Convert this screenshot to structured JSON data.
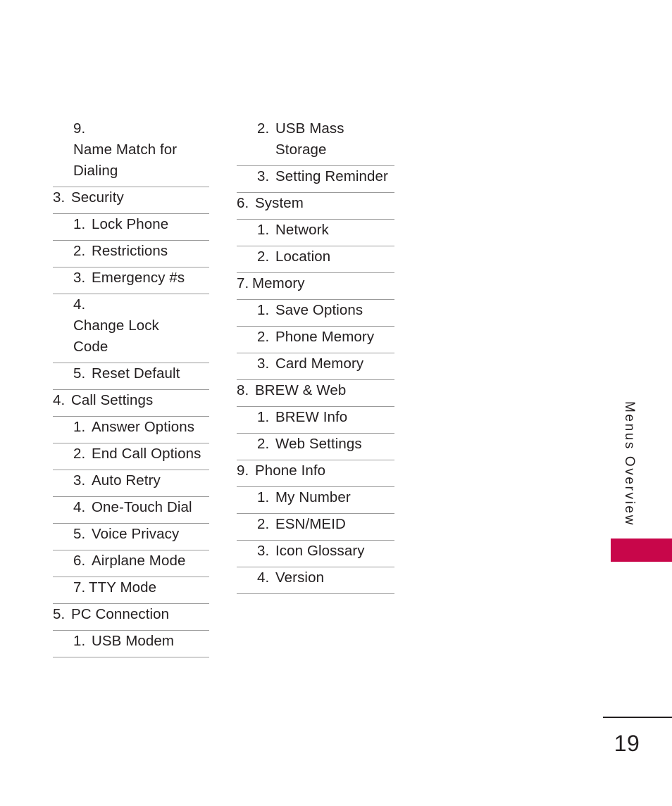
{
  "page": {
    "section_tab": "Menus Overview",
    "folio": "19",
    "accent_color": "#c8064a",
    "text_color": "#231f20",
    "rule_color": "#9b9b9b",
    "background": "#ffffff"
  },
  "columns": {
    "left": [
      {
        "num": "9.",
        "text": "Name Match for Dialing",
        "level": 2
      },
      {
        "num": "3.",
        "text": "Security",
        "level": 1
      },
      {
        "num": "1.",
        "text": "Lock Phone",
        "level": 2
      },
      {
        "num": "2.",
        "text": "Restrictions",
        "level": 2
      },
      {
        "num": "3.",
        "text": "Emergency #s",
        "level": 2
      },
      {
        "num": "4.",
        "text": "Change Lock Code",
        "level": 2
      },
      {
        "num": "5.",
        "text": "Reset Default",
        "level": 2
      },
      {
        "num": "4.",
        "text": "Call Settings",
        "level": 1
      },
      {
        "num": "1.",
        "text": "Answer Options",
        "level": 2
      },
      {
        "num": "2.",
        "text": "End Call Options",
        "level": 2
      },
      {
        "num": "3.",
        "text": "Auto Retry",
        "level": 2
      },
      {
        "num": "4.",
        "text": "One-Touch Dial",
        "level": 2
      },
      {
        "num": "5.",
        "text": "Voice Privacy",
        "level": 2
      },
      {
        "num": "6.",
        "text": "Airplane Mode",
        "level": 2
      },
      {
        "num": "7.",
        "text": "TTY Mode",
        "level": 2
      },
      {
        "num": "5.",
        "text": "PC Connection",
        "level": 1
      },
      {
        "num": "1.",
        "text": "USB Modem",
        "level": 2
      }
    ],
    "right": [
      {
        "num": "2.",
        "text": "USB Mass Storage",
        "level": 2
      },
      {
        "num": "3.",
        "text": "Setting Reminder",
        "level": 2
      },
      {
        "num": "6.",
        "text": "System",
        "level": 1
      },
      {
        "num": "1.",
        "text": "Network",
        "level": 2
      },
      {
        "num": "2.",
        "text": "Location",
        "level": 2
      },
      {
        "num": "7.",
        "text": "Memory",
        "level": 1
      },
      {
        "num": "1.",
        "text": "Save Options",
        "level": 2
      },
      {
        "num": "2.",
        "text": "Phone Memory",
        "level": 2
      },
      {
        "num": "3.",
        "text": "Card Memory",
        "level": 2
      },
      {
        "num": "8.",
        "text": "BREW & Web",
        "level": 1
      },
      {
        "num": "1.",
        "text": "BREW Info",
        "level": 2
      },
      {
        "num": "2.",
        "text": "Web Settings",
        "level": 2
      },
      {
        "num": "9.",
        "text": "Phone Info",
        "level": 1
      },
      {
        "num": "1.",
        "text": "My Number",
        "level": 2
      },
      {
        "num": "2.",
        "text": "ESN/MEID",
        "level": 2
      },
      {
        "num": "3.",
        "text": "Icon Glossary",
        "level": 2
      },
      {
        "num": "4.",
        "text": "Version",
        "level": 2
      }
    ]
  }
}
